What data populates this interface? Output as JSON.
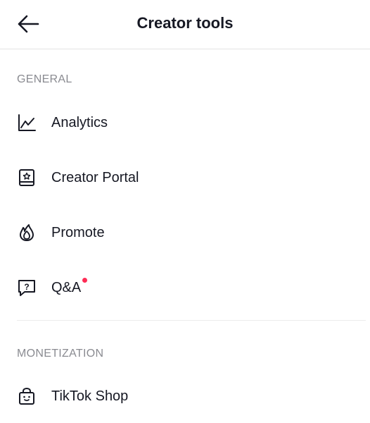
{
  "header": {
    "title": "Creator tools",
    "back_icon": "arrow-left-icon"
  },
  "sections": [
    {
      "label": "GENERAL",
      "items": [
        {
          "label": "Analytics",
          "icon": "analytics-chart-icon"
        },
        {
          "label": "Creator Portal",
          "icon": "creator-portal-icon"
        },
        {
          "label": "Promote",
          "icon": "flame-icon"
        },
        {
          "label": "Q&A",
          "icon": "question-bubble-icon",
          "has_notification_dot": true
        }
      ]
    },
    {
      "label": "MONETIZATION",
      "items": [
        {
          "label": "TikTok Shop",
          "icon": "shopping-bag-icon"
        }
      ]
    }
  ],
  "colors": {
    "text_primary": "#161823",
    "text_secondary": "#8a8b91",
    "divider": "#ececec",
    "notification_dot": "#fe2c55"
  }
}
